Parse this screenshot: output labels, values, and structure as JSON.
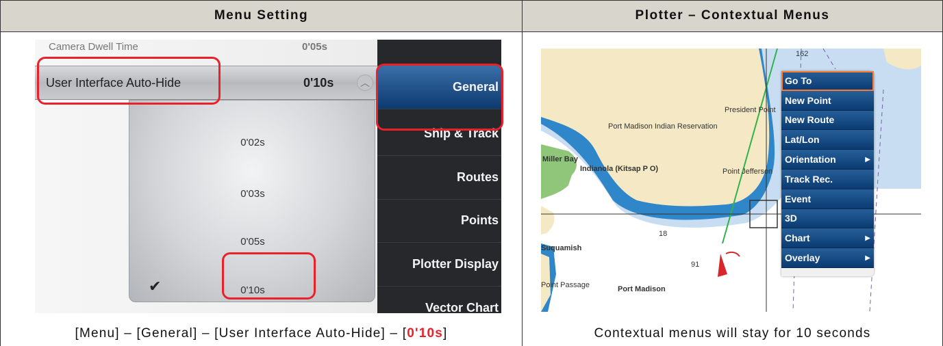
{
  "headers": {
    "left": "Menu Setting",
    "right": "Plotter – Contextual Menus"
  },
  "left_screenshot": {
    "cut_row_label": "Camera Dwell Time",
    "cut_row_value": "0'05s",
    "setting_label": "User Interface Auto-Hide",
    "setting_value": "0'10s",
    "options": [
      "0'02s",
      "0'03s",
      "0'05s",
      "0'10s"
    ],
    "selected_option": "0'10s",
    "sidebar_items": [
      "General",
      "Ship & Track",
      "Routes",
      "Points",
      "Plotter Display",
      "Vector Chart"
    ],
    "active_sidebar_item": "General"
  },
  "right_screenshot": {
    "map_labels": {
      "president_point": "President Point",
      "port_madison_reservation": "Port Madison Indian Reservation",
      "miller_bay": "Miller Bay",
      "indianola": "Indianola (Kitsap P O)",
      "point_jefferson": "Point Jefferson",
      "suquamish": "Suquamish",
      "port_madison": "Port Madison",
      "point_passage": "Point Passage",
      "depth_18": "18",
      "depth_91": "91",
      "depth_162": "162"
    },
    "context_menu": [
      {
        "label": "Go To",
        "submenu": false
      },
      {
        "label": "New Point",
        "submenu": false
      },
      {
        "label": "New Route",
        "submenu": false
      },
      {
        "label": "Lat/Lon",
        "submenu": false
      },
      {
        "label": "Orientation",
        "submenu": true
      },
      {
        "label": "Track Rec.",
        "submenu": false
      },
      {
        "label": "Event",
        "submenu": false
      },
      {
        "label": "3D",
        "submenu": false
      },
      {
        "label": "Chart",
        "submenu": true
      },
      {
        "label": "Overlay",
        "submenu": true
      }
    ],
    "selected_menu_item": "Go To"
  },
  "captions": {
    "left_prefix": "[Menu] – [General] – [User Interface Auto-Hide] – [",
    "left_value": "0'10s",
    "left_suffix": "]",
    "right": "Contextual menus will stay for 10 seconds"
  },
  "colors": {
    "highlight_red": "#e8212a",
    "menu_blue": "#0b3b72",
    "header_bg": "#d8d5cc"
  }
}
